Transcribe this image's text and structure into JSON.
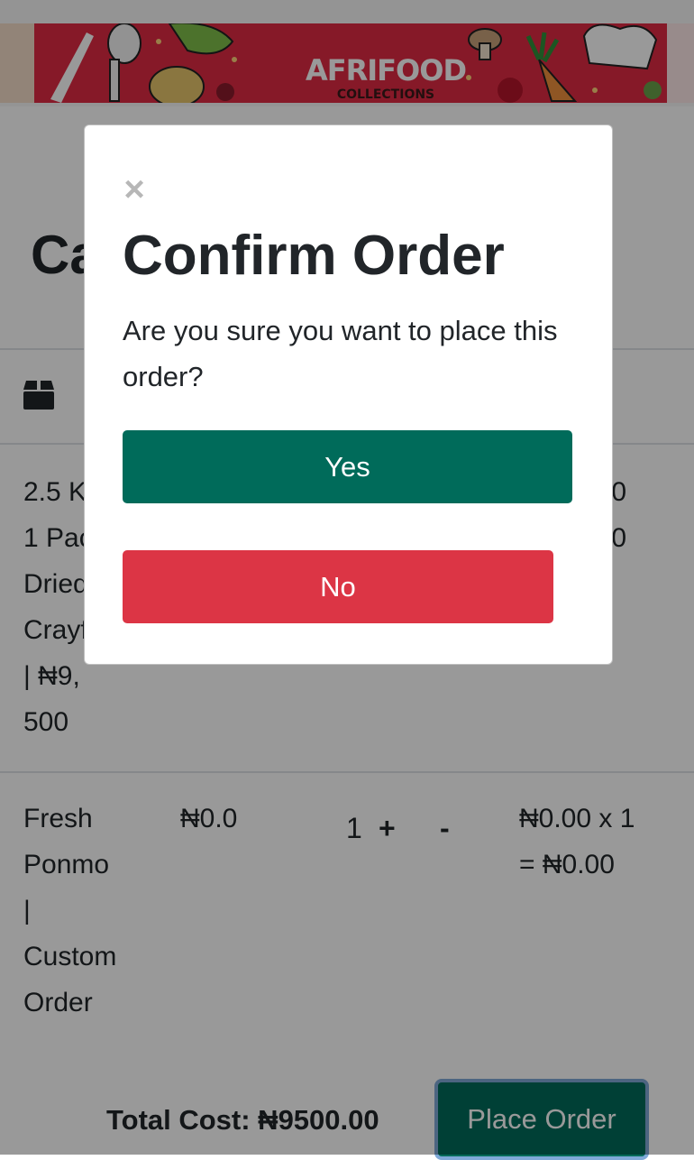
{
  "banner": {
    "brand": "AFRIFOOD",
    "sub": "COLLECTIONS"
  },
  "cart": {
    "title": "Cart",
    "items": [
      {
        "name_lines": [
          "2.5 Kg",
          "1 Pack",
          "Dried",
          "Crayfish",
          "| ₦9,",
          "500"
        ],
        "subtotal_lines": [
          "₦0.00",
          "₦0.00"
        ]
      },
      {
        "name_lines": [
          "Fresh",
          "Ponmo",
          "|",
          "Custom",
          "Order"
        ],
        "price": "₦0.0",
        "quantity": "1",
        "plus_label": "+",
        "minus_label": "-",
        "subtotal_lines": [
          "₦0.00 x 1",
          "= ₦0.00"
        ]
      }
    ],
    "total_label": "Total Cost: ₦9500.00",
    "place_order_label": "Place Order"
  },
  "modal": {
    "close_glyph": "×",
    "title": "Confirm Order",
    "message": "Are you sure you want to place this order?",
    "yes_label": "Yes",
    "no_label": "No"
  },
  "colors": {
    "primary": "#006b5a",
    "danger": "#dc3545",
    "banner": "#e02b43"
  }
}
